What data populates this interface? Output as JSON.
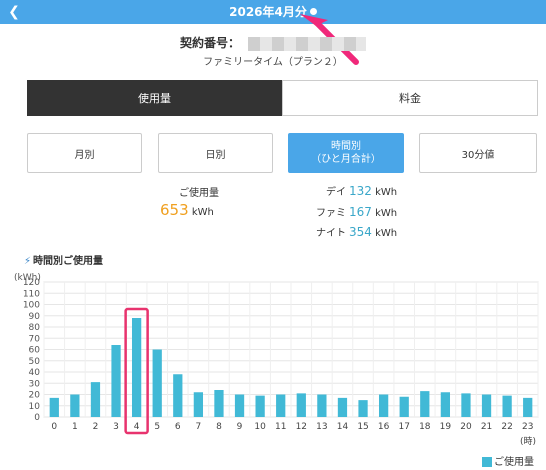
{
  "header": {
    "title": "2026年4月分",
    "back_icon": "chevron-left-icon",
    "dropdown_icon": "caret-down-icon"
  },
  "contract": {
    "label": "契約番号：",
    "plan": "ファミリータイム（プラン２）"
  },
  "segments": {
    "usage": "使用量",
    "fee": "料金"
  },
  "tabs": [
    {
      "label": "月別"
    },
    {
      "label": "日別"
    },
    {
      "label": "時間別",
      "sub": "（ひと月合計）",
      "active": true
    },
    {
      "label": "30分値"
    }
  ],
  "summary": {
    "total_label": "ご使用量",
    "total_value": "653",
    "unit": "kWh",
    "breakdown": [
      {
        "label": "デイ",
        "value": "132",
        "unit": "kWh"
      },
      {
        "label": "ファミ",
        "value": "167",
        "unit": "kWh"
      },
      {
        "label": "ナイト",
        "value": "354",
        "unit": "kWh"
      }
    ]
  },
  "chart_title": "時間別ご使用量",
  "chart_data": {
    "type": "bar",
    "categories": [
      "0",
      "1",
      "2",
      "3",
      "4",
      "5",
      "6",
      "7",
      "8",
      "9",
      "10",
      "11",
      "12",
      "13",
      "14",
      "15",
      "16",
      "17",
      "18",
      "19",
      "20",
      "21",
      "22",
      "23"
    ],
    "values": [
      17,
      20,
      31,
      64,
      88,
      60,
      38,
      22,
      24,
      20,
      19,
      20,
      21,
      20,
      17,
      15,
      20,
      18,
      23,
      22,
      21,
      20,
      19,
      17
    ],
    "ylabel": "(kWh)",
    "xlabel": "(時)",
    "ylim": [
      0,
      120
    ],
    "yticks": [
      0,
      10,
      20,
      30,
      40,
      50,
      60,
      70,
      80,
      90,
      100,
      110,
      120
    ],
    "highlight_index": 4,
    "bar_color": "#41b9d6",
    "highlight_color": "#e8336e",
    "legend": "ご使用量",
    "grid": true
  },
  "colors": {
    "header": "#4aa6e8",
    "accent_orange": "#f0a020",
    "accent_teal": "#3aa7c9",
    "annotation_arrow": "#f0287a"
  }
}
